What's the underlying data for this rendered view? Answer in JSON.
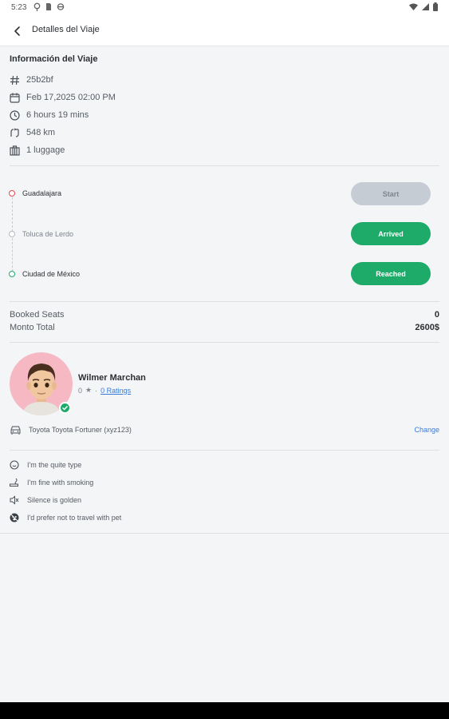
{
  "status_bar": {
    "time": "5:23"
  },
  "app_bar": {
    "title": "Detalles del Viaje"
  },
  "trip_info": {
    "section_title": "Información del Viaje",
    "id": "25b2bf",
    "date": "Feb 17,2025 02:00 PM",
    "duration": "6 hours 19 mins",
    "distance": "548 km",
    "luggage": "1 luggage"
  },
  "stops": [
    {
      "name": "Guadalajara",
      "button": "Start",
      "dot_color": "#e5484d"
    },
    {
      "name": "Toluca de Lerdo",
      "button": "Arrived",
      "dot_color": "#b5bbc2"
    },
    {
      "name": "Ciudad de México",
      "button": "Reached",
      "dot_color": "#1eab6a"
    }
  ],
  "summary": {
    "booked_seats_label": "Booked Seats",
    "booked_seats_value": "0",
    "total_label": "Monto Total",
    "total_value": "2600$"
  },
  "driver": {
    "name": "Wilmer Marchan",
    "rating": "0",
    "ratings_link": "0 Ratings"
  },
  "vehicle": {
    "description": "Toyota Toyota Fortuner (xyz123)",
    "change_label": "Change"
  },
  "preferences": [
    {
      "text": "I'm the quite type",
      "icon": "chat-smile-icon"
    },
    {
      "text": "I'm fine with smoking",
      "icon": "smoking-icon"
    },
    {
      "text": "Silence is golden",
      "icon": "speaker-mute-icon"
    },
    {
      "text": "I'd prefer not to travel with pet",
      "icon": "no-pet-icon"
    }
  ],
  "colors": {
    "accent_green": "#1eab6a",
    "disabled_grey": "#c6ccd3",
    "link_blue": "#3b7bd8",
    "avatar_pink": "#f6b9c3",
    "origin_red": "#e5484d"
  }
}
